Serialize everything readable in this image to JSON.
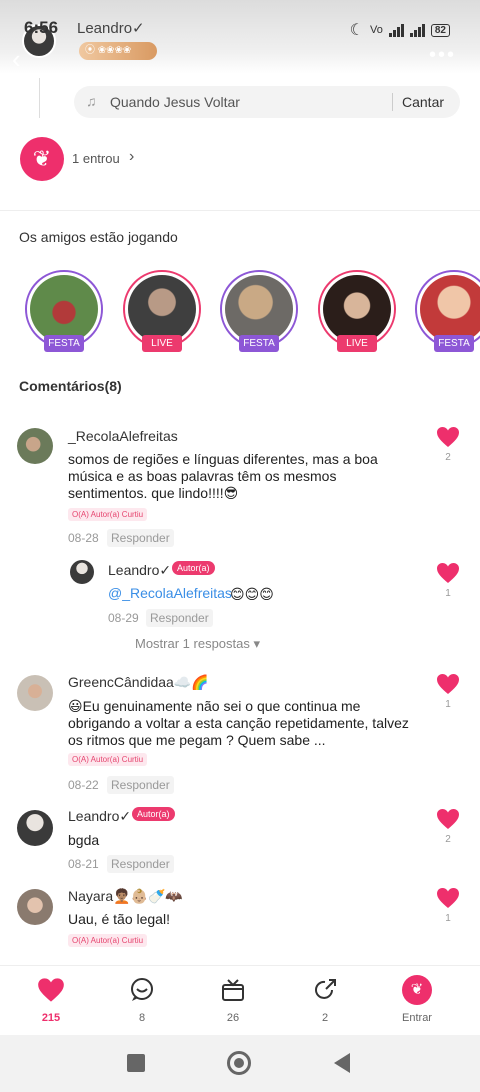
{
  "status": {
    "time": "6:56",
    "battery": "82"
  },
  "header": {
    "author_name": "Leandro✓",
    "level_badge": "⦿ ❀❀❀❀"
  },
  "song": {
    "title": "Quando Jesus Voltar",
    "sing_label": "Cantar"
  },
  "party": {
    "joined_text": "1 entrou"
  },
  "friends": {
    "title": "Os amigos estão jogando",
    "stories": [
      {
        "tag": "FESTA"
      },
      {
        "tag": "LIVE"
      },
      {
        "tag": "FESTA"
      },
      {
        "tag": "LIVE"
      },
      {
        "tag": "FESTA"
      }
    ]
  },
  "comments": {
    "title": "Comentários(8)",
    "liked_label": "O(A) Autor(a) Curtiu",
    "reply_label": "Responder",
    "author_tag": "Autor(a)",
    "show_replies": "Mostrar 1 respostas ▾",
    "items": [
      {
        "name": "_RecolaAlefreitas",
        "line1": "somos de regiões e línguas diferentes, mas a boa",
        "line2": "música e as boas palavras têm os mesmos",
        "line3": "sentimentos. que lindo!!!!😎",
        "date": "08-28",
        "likes": "2"
      },
      {
        "name": "Leandro✓",
        "mention": "@_RecolaAlefreitas",
        "emoji": "😊😊😊",
        "date": "08-29",
        "likes": "1"
      },
      {
        "name": "GreencCândidaa☁️🌈",
        "line1": "😃Eu genuinamente não sei o que continua me",
        "line2": "obrigando a voltar a esta canção repetidamente, talvez",
        "line3": "os ritmos que me pegam ? Quem sabe ...",
        "date": "08-22",
        "likes": "1"
      },
      {
        "name": "Leandro✓",
        "line1": "bgda",
        "date": "08-21",
        "likes": "2"
      },
      {
        "name": "Nayara🧑🏽‍🦱👶🏼🍼🦇",
        "line1": "Uau, é tão legal!",
        "likes": "1"
      }
    ]
  },
  "nav": {
    "likes": "215",
    "comments": "8",
    "gifts": "26",
    "shares": "2",
    "enter": "Entrar"
  },
  "colors": {
    "accent": "#ee2f6c",
    "festa": "#8d57d6",
    "mention": "#3a8ee6"
  }
}
